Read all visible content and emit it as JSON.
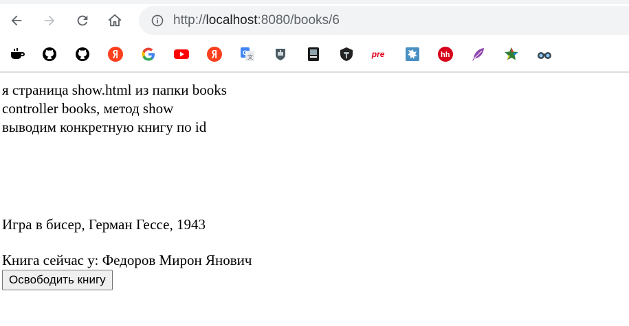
{
  "browser": {
    "url_scheme": "http://",
    "url_host": "localhost",
    "url_rest": ":8080/books/6",
    "bookmarks": [
      {
        "name": "coffee-icon",
        "color": "#000000"
      },
      {
        "name": "github-icon",
        "color": "#000000"
      },
      {
        "name": "github-icon",
        "color": "#000000"
      },
      {
        "name": "yandex-icon",
        "color": "#fc3f1d"
      },
      {
        "name": "google-icon",
        "color": "#4285f4"
      },
      {
        "name": "youtube-icon",
        "color": "#ff0000"
      },
      {
        "name": "yandex-icon",
        "color": "#fc3f1d"
      },
      {
        "name": "translate-icon",
        "color": "#4285f4"
      },
      {
        "name": "warships-icon",
        "color": "#333333"
      },
      {
        "name": "book-icon",
        "color": "#1a1a1a"
      },
      {
        "name": "tanks-icon",
        "color": "#222222"
      },
      {
        "name": "pre-icon",
        "color": "#e0001b",
        "text": "pre"
      },
      {
        "name": "puzzle-icon",
        "color": "#4a90c2"
      },
      {
        "name": "hh-icon",
        "color": "#d6001c",
        "text": "hh"
      },
      {
        "name": "feather-icon",
        "color": "#8e44ad"
      },
      {
        "name": "star-icon",
        "color": "#2e7d32"
      },
      {
        "name": "binoculars-icon",
        "color": "#37474f"
      }
    ]
  },
  "page": {
    "intro_lines": [
      "я страница show.html из папки books",
      "controller books, метод show",
      "выводим конкретную книгу по id"
    ],
    "book_info": "Игра в бисер, Герман Гессе, 1943",
    "owner_info": "Книга сейчас у: Федоров Мирон Янович",
    "release_button": "Освободить книгу"
  }
}
